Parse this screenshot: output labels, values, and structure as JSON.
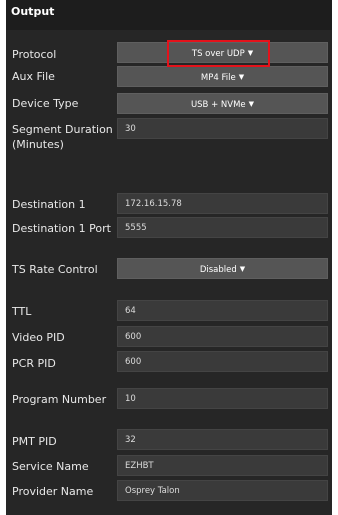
{
  "header": {
    "title": "Output"
  },
  "rows": {
    "protocol": {
      "label": "Protocol",
      "value": "TS over UDP"
    },
    "aux_file": {
      "label": "Aux File",
      "value": "MP4 File"
    },
    "device_type": {
      "label": "Device Type",
      "value": "USB + NVMe"
    },
    "segment_duration": {
      "label": "Segment Duration (Minutes)",
      "value": "30"
    },
    "destination1": {
      "label": "Destination 1",
      "value": "172.16.15.78"
    },
    "destination1_port": {
      "label": "Destination 1 Port",
      "value": "5555"
    },
    "ts_rate_control": {
      "label": "TS Rate Control",
      "value": "Disabled"
    },
    "ttl": {
      "label": "TTL",
      "value": "64"
    },
    "video_pid": {
      "label": "Video PID",
      "value": "600"
    },
    "pcr_pid": {
      "label": "PCR PID",
      "value": "600"
    },
    "program_number": {
      "label": "Program Number",
      "value": "10"
    },
    "pmt_pid": {
      "label": "PMT PID",
      "value": "32"
    },
    "service_name": {
      "label": "Service Name",
      "value": "EZHBT"
    },
    "provider_name": {
      "label": "Provider Name",
      "value": "Osprey Talon"
    }
  },
  "icons": {
    "dropdown_caret": "caret-down-icon"
  },
  "colors": {
    "panel": "#262626",
    "header": "#1d1d1d",
    "dropdown": "#555555",
    "input": "#3a3a3a",
    "highlight": "#e4121b"
  }
}
